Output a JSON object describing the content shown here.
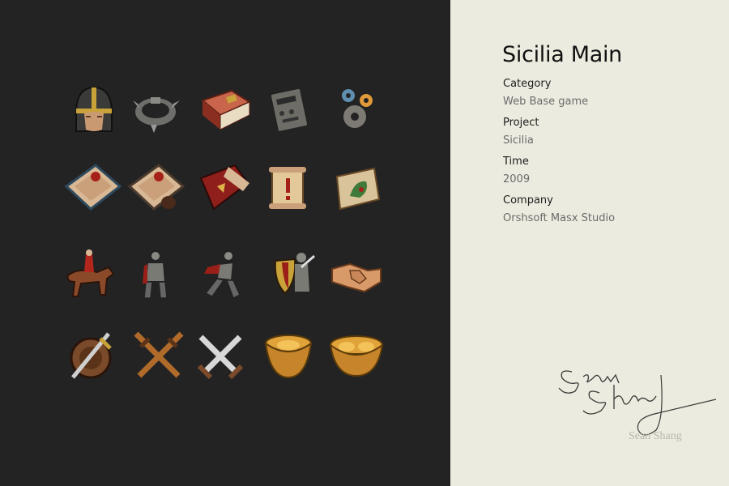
{
  "title": "Sicilia Main",
  "details": [
    {
      "label": "Category",
      "value": "Web Base game"
    },
    {
      "label": "Project",
      "value": "Sicilia"
    },
    {
      "label": "Time",
      "value": "2009"
    },
    {
      "label": "Company",
      "value": "Orshsoft Masx Studio"
    }
  ],
  "signature_text": "Sean Shang",
  "icons": [
    [
      "helmet-icon",
      "spiked-bracelet-icon",
      "book-icon",
      "control-panel-icon",
      "gears-icon"
    ],
    [
      "sealed-letter-icon",
      "letter-with-bag-icon",
      "red-decree-icon",
      "scroll-notice-icon",
      "map-scroll-icon"
    ],
    [
      "cavalry-icon",
      "infantry-icon",
      "running-soldier-icon",
      "shield-knight-icon",
      "handshake-icon"
    ],
    [
      "sword-shield-icon",
      "crossed-bronze-swords-icon",
      "crossed-steel-swords-icon",
      "gold-ingot-icon",
      "gold-ingots-icon"
    ]
  ]
}
